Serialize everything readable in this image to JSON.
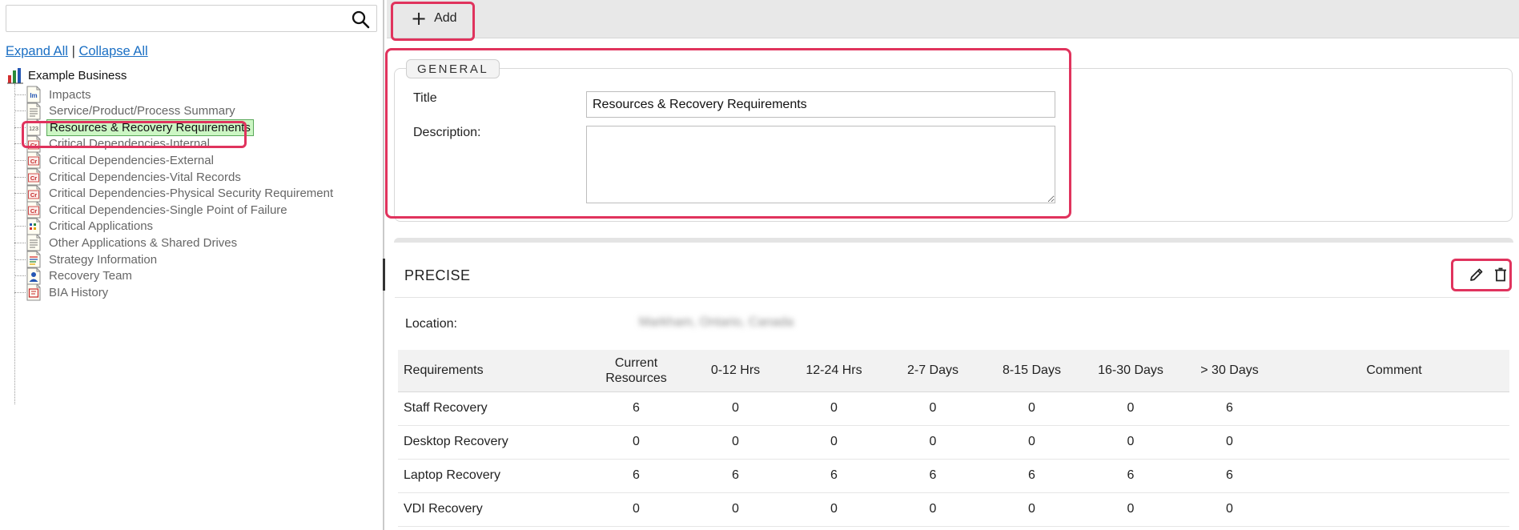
{
  "colors": {
    "highlight": "#e0335d",
    "link": "#1a6fc4",
    "selected_bg": "#ccf6c4"
  },
  "sidebar": {
    "search": {
      "value": "",
      "icon": "search-icon"
    },
    "expand_all": "Expand All",
    "separator": "|",
    "collapse_all": "Collapse All",
    "tree": {
      "root": {
        "label": "Example Business",
        "icon": "bar-chart-icon"
      },
      "items": [
        {
          "label": "Impacts",
          "icon": "impact-doc-icon"
        },
        {
          "label": "Service/Product/Process Summary",
          "icon": "text-doc-icon"
        },
        {
          "label": "Resources & Recovery Requirements",
          "icon": "numbers-doc-icon",
          "selected": true
        },
        {
          "label": "Critical Dependencies-Internal",
          "icon": "critical-doc-icon"
        },
        {
          "label": "Critical Dependencies-External",
          "icon": "critical-doc-icon"
        },
        {
          "label": "Critical Dependencies-Vital Records",
          "icon": "critical-doc-icon"
        },
        {
          "label": "Critical Dependencies-Physical Security Requirement",
          "icon": "critical-doc-icon"
        },
        {
          "label": "Critical Dependencies-Single Point of Failure",
          "icon": "critical-doc-icon"
        },
        {
          "label": "Critical Applications",
          "icon": "apps-doc-icon"
        },
        {
          "label": "Other Applications & Shared Drives",
          "icon": "text-doc-icon"
        },
        {
          "label": "Strategy Information",
          "icon": "strategy-doc-icon"
        },
        {
          "label": "Recovery Team",
          "icon": "team-doc-icon"
        },
        {
          "label": "BIA History",
          "icon": "history-doc-icon"
        }
      ]
    }
  },
  "toolbar": {
    "add_label": "Add"
  },
  "general": {
    "legend": "GENERAL",
    "title_label": "Title",
    "title_value": "Resources & Recovery Requirements",
    "description_label": "Description:",
    "description_value": ""
  },
  "precise": {
    "title": "PRECISE",
    "location_label": "Location:",
    "location_value": "Markham, Ontario, Canada",
    "columns": [
      "Requirements",
      "Current Resources",
      "0-12 Hrs",
      "12-24 Hrs",
      "2-7 Days",
      "8-15 Days",
      "16-30 Days",
      "> 30 Days",
      "Comment"
    ],
    "rows": [
      [
        "Staff Recovery",
        "6",
        "0",
        "0",
        "0",
        "0",
        "0",
        "6",
        ""
      ],
      [
        "Desktop Recovery",
        "0",
        "0",
        "0",
        "0",
        "0",
        "0",
        "0",
        ""
      ],
      [
        "Laptop Recovery",
        "6",
        "6",
        "6",
        "6",
        "6",
        "6",
        "6",
        ""
      ],
      [
        "VDI Recovery",
        "0",
        "0",
        "0",
        "0",
        "0",
        "0",
        "0",
        ""
      ]
    ]
  }
}
